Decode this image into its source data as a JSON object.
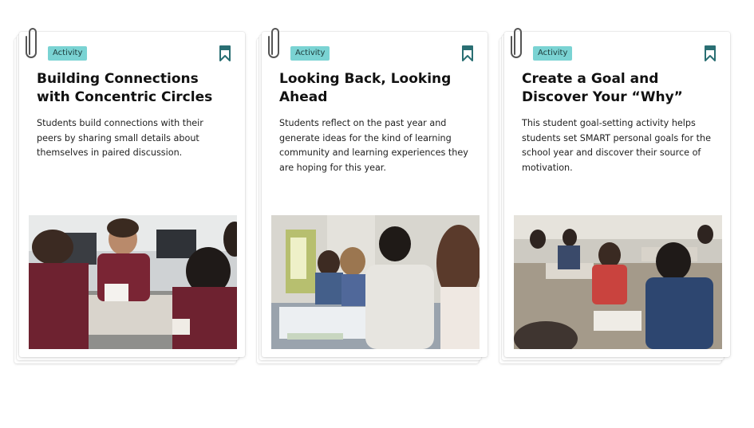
{
  "cards": [
    {
      "badge": "Activity",
      "title": "Building Connections with Concentric Circles",
      "description": "Students build connections with their peers by sharing small details about themselves in paired discussion.",
      "image": "photo of students in maroon shirts talking at a classroom table"
    },
    {
      "badge": "Activity",
      "title": "Looking Back, Looking Ahead",
      "description": "Students reflect on the past year and generate ideas for the kind of learning community and learning experiences they are hoping for this year.",
      "image": "photo of students in hoodies discussing with papers on desks"
    },
    {
      "badge": "Activity",
      "title": "Create a Goal and Discover Your “Why”",
      "description": "This student goal-setting activity helps students set SMART personal goals for the school year and discover their source of motivation.",
      "image": "photo of classroom with students seated at desks raising hands"
    }
  ],
  "colors": {
    "badge_bg": "#7ad3d3",
    "bookmark": "#2a6f73",
    "clip": "#555555"
  },
  "icons": [
    "paperclip-icon",
    "bookmark-icon"
  ]
}
